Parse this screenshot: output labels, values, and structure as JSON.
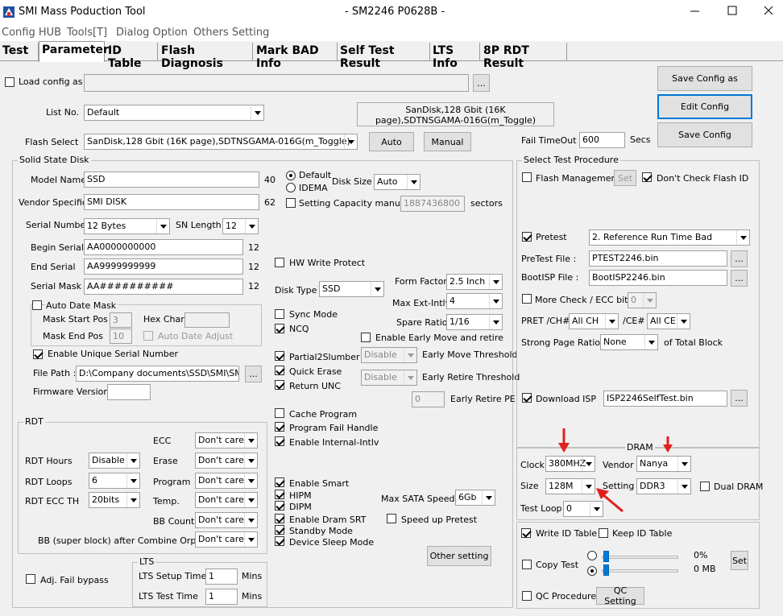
{
  "window": {
    "app_title": "SMI Mass Poduction Tool",
    "center_title": "- SM2246 P0628B -"
  },
  "menu": [
    "Config HUB",
    "Tools[T]",
    "Dialog Option",
    "Others Setting"
  ],
  "tabs": [
    "Test",
    "Parameter",
    "ID Table",
    "Flash Diagnosis",
    "Mark BAD Info",
    "Self Test Result",
    "LTS Info",
    "8P RDT Result"
  ],
  "top": {
    "load_config_label": "Load config as",
    "load_config_value": "",
    "browse": "...",
    "list_no_label": "List No.",
    "list_no_value": "Default",
    "flash_info": "SanDisk,128 Gbit (16K page),SDTNSGAMA-016G(m_Toggle)",
    "flash_select_label": "Flash Select",
    "flash_select_value": "SanDisk,128 Gbit (16K page),SDTNSGAMA-016G(m_Toggle)",
    "auto_btn": "Auto",
    "manual_btn": "Manual",
    "save_config_as": "Save Config as",
    "edit_config": "Edit Config",
    "save_config": "Save Config",
    "fail_timeout_label": "Fail TimeOut",
    "fail_timeout_value": "600",
    "fail_timeout_unit": "Secs"
  },
  "ssd": {
    "group_title": "Solid State Disk",
    "model_name_label": "Model Name",
    "model_name_value": "SSD",
    "model_name_max": "40",
    "vendor_label": "Vendor Specific",
    "vendor_value": "SMI DISK",
    "vendor_max": "62",
    "default_label": "Default",
    "idema_label": "IDEMA",
    "disk_size_label": "Disk Size",
    "disk_size_value": "Auto",
    "setting_capacity_label": "Setting Capacity manually",
    "capacity_value": "1887436800",
    "sectors": "sectors",
    "serial_number_label": "Serial Number",
    "serial_number_value": "12 Bytes",
    "sn_length_label": "SN Length",
    "sn_length_value": "12",
    "begin_serial_label": "Begin Serial",
    "begin_serial_value": "AA0000000000",
    "begin_serial_len": "12",
    "end_serial_label": "End Serial",
    "end_serial_value": "AA9999999999",
    "end_serial_len": "12",
    "serial_mask_label": "Serial Mask",
    "serial_mask_value": "AA##########",
    "serial_mask_len": "12",
    "hw_write_protect": "HW Write Protect",
    "auto_date_mask": "Auto Date Mask",
    "mask_start_label": "Mask Start Pos",
    "mask_start_value": "3",
    "hex_char_label": "Hex Char:",
    "hex_char_value": "",
    "mask_end_label": "Mask End Pos",
    "mask_end_value": "10",
    "auto_date_adjust": "Auto Date Adjust",
    "enable_unique": "Enable Unique Serial Number",
    "file_path_label": "File Path :",
    "file_path_value": "D:\\Company documents\\SSD\\SMI\\SM224",
    "firmware_label": "Firmware Version",
    "firmware_value": "",
    "disk_type_label": "Disk Type",
    "disk_type_value": "SSD",
    "form_factor_label": "Form Factor",
    "form_factor_value": "2.5 Inch",
    "max_ext_label": "Max Ext-Intlv",
    "max_ext_value": "4",
    "spare_ratio_label": "Spare Ratio",
    "spare_ratio_value": "1/16",
    "sync_mode": "Sync Mode",
    "ncq": "NCQ",
    "early_move": "Enable Early Move and retire",
    "partial2slumber": "Partial2Slumber",
    "quick_erase": "Quick Erase",
    "return_unc": "Return UNC",
    "early_move_sel": "Disable",
    "early_move_threshold": "Early Move Threshold",
    "early_retire_sel": "Disable",
    "early_retire_threshold": "Early Retire Threshold",
    "early_retire_pe_value": "0",
    "early_retire_pe": "Early Retire PE",
    "cache_program": "Cache Program",
    "program_fail_handle": "Program Fail Handle",
    "enable_internal_intlv": "Enable Internal-Intlv",
    "enable_smart": "Enable Smart",
    "hipm": "HIPM",
    "dipm": "DIPM",
    "enable_dram_srt": "Enable Dram SRT",
    "standby_mode": "Standby Mode",
    "device_sleep": "Device Sleep Mode",
    "max_sata_label": "Max SATA Speed",
    "max_sata_value": "6Gb",
    "speed_up_pretest": "Speed up Pretest",
    "other_setting": "Other setting"
  },
  "rdt": {
    "group_title": "RDT",
    "rdt_hours_label": "RDT Hours",
    "rdt_hours_value": "Disable",
    "rdt_loops_label": "RDT Loops",
    "rdt_loops_value": "6",
    "rdt_ecc_label": "RDT ECC TH",
    "rdt_ecc_value": "20bits",
    "ecc_label": "ECC",
    "ecc_value": "Don't care",
    "erase_label": "Erase",
    "erase_value": "Don't care",
    "program_label": "Program",
    "program_value": "Don't care",
    "temp_label": "Temp.",
    "temp_value": "Don't care",
    "bb_count_label": "BB Count",
    "bb_count_value": "Don't care",
    "bb_super_label": "BB (super block) after Combine Orphan",
    "bb_super_value": "Don't care"
  },
  "bottom_left": {
    "adj_fail_bypass": "Adj. Fail bypass",
    "lts_title": "LTS",
    "lts_setup_label": "LTS Setup Time",
    "lts_setup_value": "1",
    "lts_setup_unit": "Mins",
    "lts_test_label": "LTS Test Time",
    "lts_test_value": "1",
    "lts_test_unit": "Mins"
  },
  "procedure": {
    "group_title": "Select Test Procedure",
    "flash_management": "Flash Management",
    "set_btn": "Set",
    "dont_check_flash_id": "Don't Check Flash ID",
    "pretest": "Pretest",
    "pretest_value": "2. Reference Run Time Bad",
    "pretest_file_label": "PreTest File :",
    "pretest_file_value": "PTEST2246.bin",
    "bootisp_label": "BootISP File :",
    "bootisp_value": "BootISP2246.bin",
    "more_check": "More Check / ECC bits",
    "more_check_value": "0",
    "pret_ch_label": "PRET /CH#",
    "pret_ch_value": "All CH",
    "ce_label": "/CE#",
    "ce_value": "All CE",
    "strong_page_label": "Strong Page Ratio :",
    "strong_page_value": "None",
    "of_total_block": "of Total Block",
    "download_isp": "Download ISP",
    "download_isp_value": "ISP2246SelfTest.bin"
  },
  "dram": {
    "group_title": "DRAM",
    "clock_label": "Clock",
    "clock_value": "380MHZ",
    "vendor_label": "Vendor",
    "vendor_value": "Nanya",
    "size_label": "Size",
    "size_value": "128M",
    "setting_label": "Setting",
    "setting_value": "DDR3",
    "dual_dram": "Dual DRAM",
    "test_loop_label": "Test Loop",
    "test_loop_value": "0"
  },
  "bottom_right": {
    "write_id_table": "Write ID Table",
    "keep_id_table": "Keep ID Table",
    "copy_test": "Copy Test",
    "pct": "0%",
    "mb": "0 MB",
    "set_btn": "Set",
    "qc_procedure": "QC Procedure",
    "qc_setting": "QC Setting"
  }
}
